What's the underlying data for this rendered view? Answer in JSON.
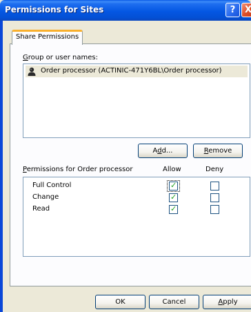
{
  "window": {
    "title": "Permissions for Sites",
    "help_glyph": "?",
    "close_glyph": "X"
  },
  "tabs": [
    {
      "label": "Share Permissions"
    }
  ],
  "groups": {
    "label_prefix": "G",
    "label_rest": "roup or user names:",
    "items": [
      {
        "name": "Order processor (ACTINIC-471Y6BL\\Order processor)",
        "icon": "user-icon",
        "selected": true
      }
    ]
  },
  "buttons": {
    "add": {
      "pre": "A",
      "u": "d",
      "post": "d..."
    },
    "remove": {
      "u": "R",
      "post": "emove"
    },
    "ok": "OK",
    "cancel": "Cancel",
    "apply": {
      "u": "A",
      "post": "pply"
    }
  },
  "permissions": {
    "label_u": "P",
    "label_rest": "ermissions for Order processor",
    "allow_header": "Allow",
    "deny_header": "Deny",
    "check_glyph": "✓",
    "rows": [
      {
        "name": "Full Control",
        "allow": true,
        "deny": false
      },
      {
        "name": "Change",
        "allow": true,
        "deny": false
      },
      {
        "name": "Read",
        "allow": true,
        "deny": false
      }
    ]
  }
}
